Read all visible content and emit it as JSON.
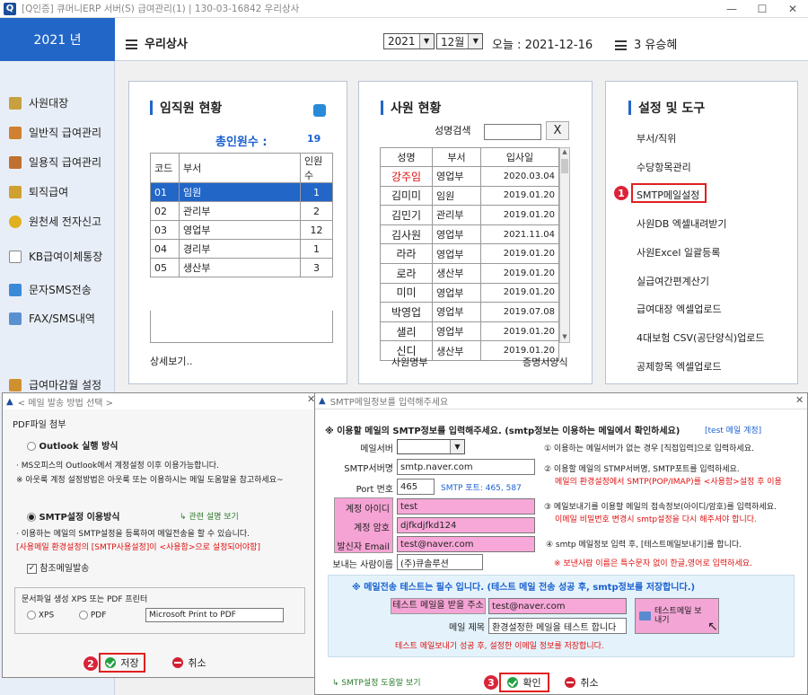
{
  "app": {
    "title": "[Q인증] 큐머니ERP 서버(S)   급여관리(1)  |  130-03-16842  우리상사",
    "min": "—",
    "max": "☐",
    "close": "✕"
  },
  "sidebar": {
    "year": "2021 년",
    "items": [
      "사원대장",
      "일반직 급여관리",
      "일용직 급여관리",
      "퇴직급여",
      "원천세 전자신고",
      "KB급여이체통장",
      "문자SMS전송",
      "FAX/SMS내역",
      "급여마감월 설정"
    ]
  },
  "topbar": {
    "company": "우리상사",
    "year": "2021",
    "month": "12월",
    "today": "오늘 : 2021-12-16",
    "user": "3 유승혜"
  },
  "staff_panel": {
    "title": "임직원 현황",
    "total_label": "총인원수 :",
    "total": "19",
    "headers": [
      "코드",
      "부서",
      "인원수"
    ],
    "rows": [
      [
        "01",
        "임원",
        "1"
      ],
      [
        "02",
        "관리부",
        "2"
      ],
      [
        "03",
        "영업부",
        "12"
      ],
      [
        "04",
        "경리부",
        "1"
      ],
      [
        "05",
        "생산부",
        "3"
      ]
    ],
    "more": "상세보기.."
  },
  "emp_panel": {
    "title": "사원 현황",
    "search_label": "성명검색",
    "search_value": "",
    "clear": "X",
    "headers": [
      "성명",
      "부서",
      "입사일"
    ],
    "rows": [
      [
        "강주임",
        "영업부",
        "2020.03.04"
      ],
      [
        "김미미",
        "임원",
        "2019.01.20"
      ],
      [
        "김민기",
        "관리부",
        "2019.01.20"
      ],
      [
        "김사원",
        "영업부",
        "2021.11.04"
      ],
      [
        "라라",
        "영업부",
        "2019.01.20"
      ],
      [
        "로라",
        "생산부",
        "2019.01.20"
      ],
      [
        "미미",
        "영업부",
        "2019.01.20"
      ],
      [
        "박영업",
        "영업부",
        "2019.07.08"
      ],
      [
        "샐리",
        "영업부",
        "2019.01.20"
      ],
      [
        "신디",
        "생산부",
        "2019.01.20"
      ]
    ],
    "footer_left": "사원명부",
    "footer_right": "증명서양식"
  },
  "tools_panel": {
    "title": "설정 및 도구",
    "items": [
      "부서/직위",
      "수당항목관리",
      "SMTP메일설정",
      "사원DB 엑셀내려받기",
      "사원Excel 일괄등록",
      "실급여간편계산기",
      "급여대장 엑셀업로드",
      "4대보험 CSV(공단양식)업로드",
      "공제항목 엑셀업로드"
    ]
  },
  "badges": [
    "1",
    "2",
    "3"
  ],
  "mail_method": {
    "title": "< 메일 발송 방법 선택 >",
    "close": "✕",
    "pdf_label": "PDF파일 첨부",
    "opt1": "Outlook 실행 방식",
    "opt1_note1": "· MS오피스의 Outlook에서 계정설정 이후 이용가능합니다.",
    "opt1_note2": "※ 아웃룩 계정 설정방법은 아웃룩 또는 이용하시는 메일 도움말을 참고하세요~",
    "opt2": "SMTP설정 이용방식",
    "opt2_help": "관련 설명 보기",
    "opt2_note1": "· 이용하는 메일의 SMTP설정을 등록하여 메일전송을 할 수 있습니다.",
    "opt2_note2": "[사용메일 환경설정의 [SMTP사용설정]이 <사용함>으로 설정되어야함]",
    "cc": "참조메일발송",
    "cc_mark": "✓",
    "printer_group": "문서파일 생성 XPS 또는 PDF 프린터",
    "xps": "XPS",
    "pdf": "PDF",
    "printer": "Microsoft Print to PDF",
    "save": "저장",
    "cancel": "취소"
  },
  "smtp": {
    "title": "SMTP메일정보를 입력해주세요",
    "close": "✕",
    "heading": "※ 이용할 메일의 SMTP정보를 입력해주세요. (smtp정보는 이용하는 메일에서 확인하세요)",
    "test_account": "[test 메일 계정]",
    "labels": {
      "server": "메일서버",
      "smtp_server": "SMTP서버명",
      "port": "Port 번호",
      "id": "계정 아이디",
      "pw": "계정 암호",
      "sender": "발신자 Email",
      "sender_name": "보내는 사람이름"
    },
    "values": {
      "server": "",
      "smtp_server": "smtp.naver.com",
      "port": "465",
      "port_hint": "SMTP 포트: 465, 587",
      "id": "test",
      "pw": "djfkdjfkd124",
      "sender": "test@naver.com",
      "sender_name": "(주)큐솔루션"
    },
    "notes": [
      "① 이용하는 메일서버가 없는 경우 [직접입력]으로 입력하세요.",
      "② 이용할 메일의 STMP서버명, SMTP포트를 입력하세요.",
      "메일의 환경설정에서 SMTP(POP/IMAP)를 <사용함>설정 후 이용",
      "③ 메일보내기를 이용할 메일의 접속정보(아이디/암호)를 입력하세요.",
      "이메일 비밀번호 변경시 smtp설정을 다시 해주셔야 합니다.",
      "④ smtp 메일정보 입력 후, [테스트메일보내기]를 합니다.",
      "※ 보낸사람 이름은 특수문자 없이 한글,영어로 입력하세요."
    ],
    "test_heading": "※ 메일전송 테스트는 필수 입니다. (테스트 메일 전송 성공 후, smtp정보를 저장합니다.)",
    "test_to_label": "테스트 메일을 받을 주소",
    "test_to": "test@naver.com",
    "subject_label": "메일 제목",
    "subject": "환경설정한 메일을 테스트 합니다",
    "test_btn": "테스트메일 보내기",
    "test_note": "테스트 메일보내기 성공 후, 설정한 이메일 정보를 저장합니다.",
    "help": "SMTP설정 도움말 보기",
    "ok": "확인",
    "cancel": "취소"
  }
}
